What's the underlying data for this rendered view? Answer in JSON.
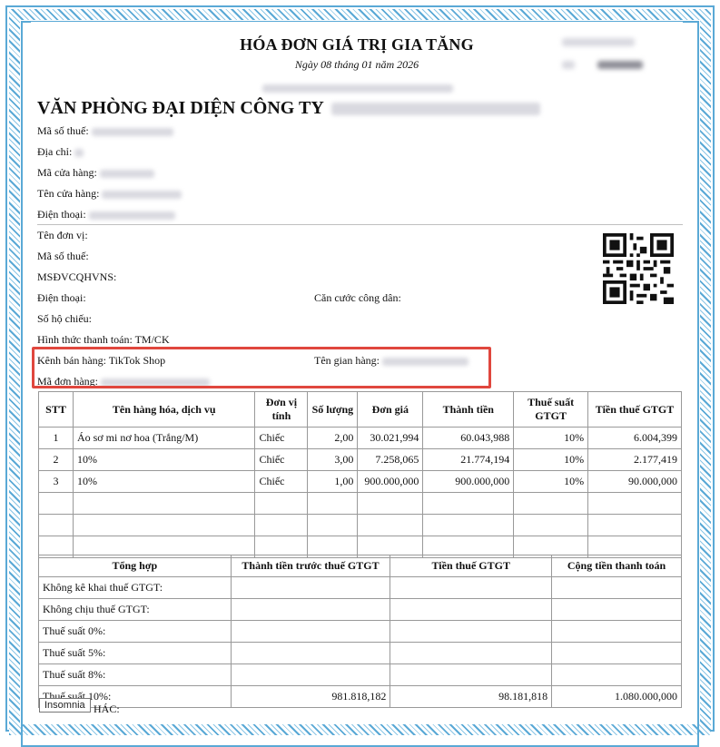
{
  "header": {
    "title": "HÓA ĐƠN GIÁ TRỊ GIA TĂNG",
    "date": "Ngày 08 tháng 01 năm 2026"
  },
  "seller": {
    "company": "VĂN PHÒNG ĐẠI DIỆN CÔNG TY",
    "tax_code_label": "Mã số thuế:",
    "address_label": "Địa chỉ:",
    "store_code_label": "Mã cửa hàng:",
    "store_name_label": "Tên cửa hàng:",
    "phone_label": "Điện thoại:"
  },
  "buyer": {
    "unit_name_label": "Tên đơn vị:",
    "tax_code_label": "Mã số thuế:",
    "msdvcqhvns_label": "MSĐVCQHVNS:",
    "phone_label": "Điện thoại:",
    "citizen_id_label": "Căn cước công dân:",
    "passport_label": "Số hộ chiếu:",
    "payment_label": "Hình thức thanh toán: TM/CK",
    "channel_label": "Kênh bán hàng: TikTok Shop",
    "booth_label": "Tên gian hàng:",
    "order_label": "Mã đơn hàng:"
  },
  "items_table": {
    "headers": [
      "STT",
      "Tên hàng hóa, dịch vụ",
      "Đơn vị tính",
      "Số lượng",
      "Đơn giá",
      "Thành tiền",
      "Thuế suất GTGT",
      "Tiền thuế GTGT"
    ],
    "rows": [
      [
        "1",
        "Áo sơ mi nơ hoa (Trắng/M)",
        "Chiếc",
        "2,00",
        "30.021,994",
        "60.043,988",
        "10%",
        "6.004,399"
      ],
      [
        "2",
        "10%",
        "Chiếc",
        "3,00",
        "7.258,065",
        "21.774,194",
        "10%",
        "2.177,419"
      ],
      [
        "3",
        "10%",
        "Chiếc",
        "1,00",
        "900.000,000",
        "900.000,000",
        "10%",
        "90.000,000"
      ]
    ]
  },
  "summary_table": {
    "headers": [
      "Tổng hợp",
      "Thành tiền trước thuế GTGT",
      "Tiền thuế GTGT",
      "Cộng tiền thanh toán"
    ],
    "rows": [
      [
        "Không kê khai thuế GTGT:",
        "",
        "",
        ""
      ],
      [
        "Không chịu thuế GTGT:",
        "",
        "",
        ""
      ],
      [
        "Thuế suất 0%:",
        "",
        "",
        ""
      ],
      [
        "Thuế suất 5%:",
        "",
        "",
        ""
      ],
      [
        "Thuế suất 8%:",
        "",
        "",
        ""
      ],
      [
        "Thuế suất 10%:",
        "981.818,182",
        "98.181,818",
        "1.080.000,000"
      ]
    ],
    "cut_row": "HÁC:"
  },
  "overlay": {
    "app_badge": "Insomnia"
  },
  "colors": {
    "frame": "#5aa9d6",
    "highlight": "#e0473e"
  }
}
